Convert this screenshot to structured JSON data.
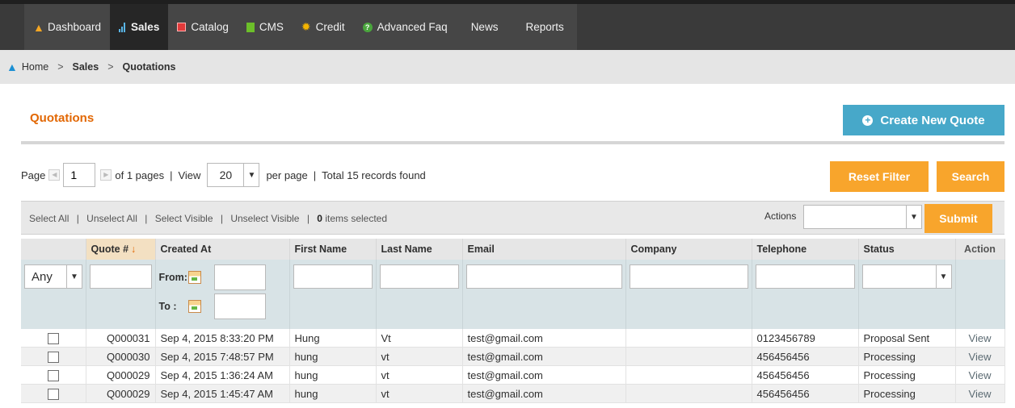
{
  "nav": {
    "items": [
      {
        "label": "Dashboard",
        "icon": "home-icon"
      },
      {
        "label": "Sales",
        "icon": "bar-chart-icon",
        "active": true
      },
      {
        "label": "Catalog",
        "icon": "catalog-icon"
      },
      {
        "label": "CMS",
        "icon": "cms-icon"
      },
      {
        "label": "Credit",
        "icon": "credit-icon"
      },
      {
        "label": "Advanced Faq",
        "icon": "faq-icon"
      },
      {
        "label": "News"
      },
      {
        "label": "Reports"
      }
    ]
  },
  "breadcrumb": {
    "home": "Home",
    "sep": ">",
    "sales": "Sales",
    "current": "Quotations"
  },
  "page": {
    "title": "Quotations",
    "create_button": "Create New Quote"
  },
  "pager": {
    "page_label": "Page",
    "page_value": "1",
    "of_pages": "of 1 pages",
    "view_label": "View",
    "per_page_value": "20",
    "per_page_label": "per page",
    "total": "Total 15 records found",
    "sep": "|",
    "reset_filter": "Reset Filter",
    "search": "Search"
  },
  "massaction": {
    "select_all": "Select All",
    "unselect_all": "Unselect All",
    "select_visible": "Select Visible",
    "unselect_visible": "Unselect Visible",
    "selected_count": "0",
    "selected_suffix": "items selected",
    "sep": "|",
    "actions_label": "Actions",
    "submit": "Submit"
  },
  "grid": {
    "columns": {
      "quote": "Quote #",
      "created_at": "Created At",
      "first_name": "First Name",
      "last_name": "Last Name",
      "email": "Email",
      "company": "Company",
      "telephone": "Telephone",
      "status": "Status",
      "action": "Action"
    },
    "filter": {
      "any": "Any",
      "from": "From:",
      "to": "To :"
    },
    "rows": [
      {
        "quote": "Q000031",
        "created_at": "Sep 4, 2015 8:33:20 PM",
        "first_name": "Hung",
        "last_name": "Vt",
        "email": "test@gmail.com",
        "company": "",
        "telephone": "0123456789",
        "status": "Proposal Sent",
        "action": "View"
      },
      {
        "quote": "Q000030",
        "created_at": "Sep 4, 2015 7:48:57 PM",
        "first_name": "hung",
        "last_name": "vt",
        "email": "test@gmail.com",
        "company": "",
        "telephone": "456456456",
        "status": "Processing",
        "action": "View"
      },
      {
        "quote": "Q000029",
        "created_at": "Sep 4, 2015 1:36:24 AM",
        "first_name": "hung",
        "last_name": "vt",
        "email": "test@gmail.com",
        "company": "",
        "telephone": "456456456",
        "status": "Processing",
        "action": "View"
      },
      {
        "quote": "Q000029",
        "created_at": "Sep 4, 2015 1:45:47 AM",
        "first_name": "hung",
        "last_name": "vt",
        "email": "test@gmail.com",
        "company": "",
        "telephone": "456456456",
        "status": "Processing",
        "action": "View"
      }
    ]
  },
  "colors": {
    "accent_orange": "#f8a52c",
    "title_orange": "#e26703",
    "create_blue": "#47a8c9",
    "nav_bg": "#3a3a3a"
  }
}
